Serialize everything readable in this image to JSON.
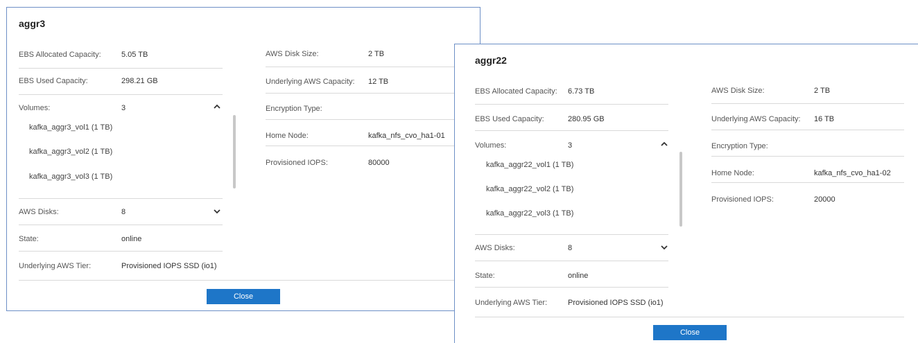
{
  "dialogs": [
    {
      "title": "aggr3",
      "left": [
        {
          "label": "EBS Allocated Capacity:",
          "value": "5.05 TB"
        },
        {
          "label": "EBS Used Capacity:",
          "value": "298.21 GB"
        }
      ],
      "volumes": {
        "label": "Volumes:",
        "count": "3",
        "items": [
          "kafka_aggr3_vol1 (1 TB)",
          "kafka_aggr3_vol2 (1 TB)",
          "kafka_aggr3_vol3 (1 TB)"
        ]
      },
      "left_bottom": [
        {
          "label": "AWS Disks:",
          "value": "8"
        },
        {
          "label": "State:",
          "value": "online"
        },
        {
          "label": "Underlying AWS Tier:",
          "value": "Provisioned IOPS SSD (io1)"
        }
      ],
      "right": [
        {
          "label": "AWS Disk Size:",
          "value": "2 TB"
        },
        {
          "label": "Underlying AWS Capacity:",
          "value": "12 TB"
        },
        {
          "label": "Encryption Type:",
          "value": ""
        },
        {
          "label": "Home Node:",
          "value": "kafka_nfs_cvo_ha1-01"
        },
        {
          "label": "Provisioned IOPS:",
          "value": "80000"
        }
      ],
      "close_label": "Close"
    },
    {
      "title": "aggr22",
      "left": [
        {
          "label": "EBS Allocated Capacity:",
          "value": "6.73 TB"
        },
        {
          "label": "EBS Used Capacity:",
          "value": "280.95 GB"
        }
      ],
      "volumes": {
        "label": "Volumes:",
        "count": "3",
        "items": [
          "kafka_aggr22_vol1 (1 TB)",
          "kafka_aggr22_vol2 (1 TB)",
          "kafka_aggr22_vol3 (1 TB)"
        ]
      },
      "left_bottom": [
        {
          "label": "AWS Disks:",
          "value": "8"
        },
        {
          "label": "State:",
          "value": "online"
        },
        {
          "label": "Underlying AWS Tier:",
          "value": "Provisioned IOPS SSD (io1)"
        }
      ],
      "right": [
        {
          "label": "AWS Disk Size:",
          "value": "2 TB"
        },
        {
          "label": "Underlying AWS Capacity:",
          "value": "16 TB"
        },
        {
          "label": "Encryption Type:",
          "value": ""
        },
        {
          "label": "Home Node:",
          "value": "kafka_nfs_cvo_ha1-02"
        },
        {
          "label": "Provisioned IOPS:",
          "value": "20000"
        }
      ],
      "close_label": "Close"
    }
  ],
  "icons": {
    "collapse": "chevron-up-icon",
    "expand": "chevron-down-icon"
  },
  "colors": {
    "accent": "#1e76c8",
    "dialog_border": "#6d8fc6",
    "divider": "#d9d9d9"
  }
}
